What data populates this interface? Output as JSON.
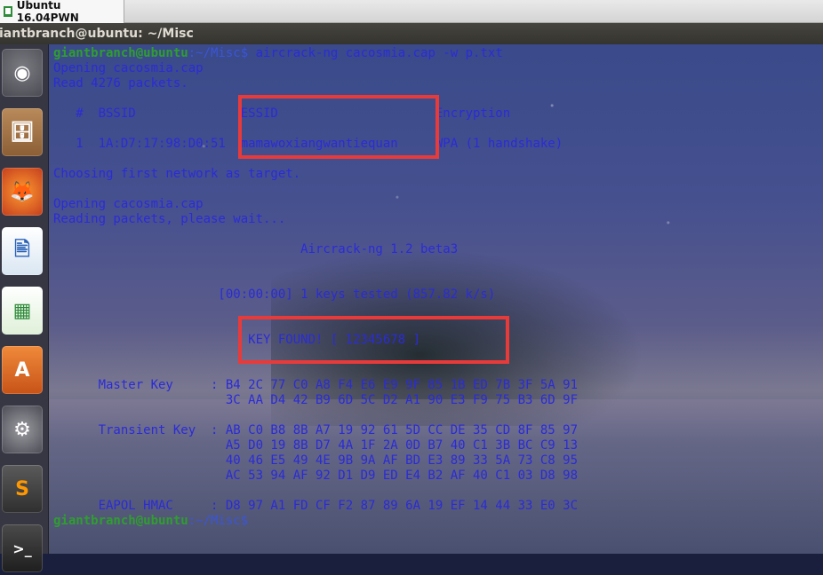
{
  "vm_tab": {
    "title": "Ubuntu 16.04PWN"
  },
  "window": {
    "title": "iantbranch@ubuntu: ~/Misc"
  },
  "launcher": {
    "items": [
      {
        "name": "ubuntu-dash-icon",
        "glyph": "◉"
      },
      {
        "name": "files-icon",
        "glyph": "🗄"
      },
      {
        "name": "firefox-icon",
        "glyph": "🦊"
      },
      {
        "name": "libreoffice-writer-icon",
        "glyph": "🖹"
      },
      {
        "name": "libreoffice-calc-icon",
        "glyph": "▦"
      },
      {
        "name": "software-center-icon",
        "glyph": "A"
      },
      {
        "name": "system-settings-icon",
        "glyph": "⚙"
      },
      {
        "name": "sublime-text-icon",
        "glyph": "S"
      },
      {
        "name": "terminal-icon",
        "glyph": ">_"
      }
    ]
  },
  "terminal": {
    "prompt_user": "giantbranch@ubuntu",
    "prompt_path": ":~/Misc",
    "prompt_symbol": "$",
    "command": " aircrack-ng cacosmia.cap -w p.txt",
    "lines": [
      "Opening cacosmia.cap",
      "Read 4276 packets.",
      "",
      "   #  BSSID              ESSID                     Encryption",
      "",
      "   1  1A:D7:17:98:D0:51  mamawoxiangwantiequan     WPA (1 handshake)",
      "",
      "Choosing first network as target.",
      "",
      "Opening cacosmia.cap",
      "Reading packets, please wait...",
      "",
      "                                 Aircrack-ng 1.2 beta3",
      "",
      "",
      "                      [00:00:00] 1 keys tested (857.82 k/s)",
      "",
      "",
      "                          KEY FOUND! [ 12345678 ]",
      "",
      "",
      "      Master Key     : B4 2C 77 C0 A8 F4 E6 E9 9F 85 1B ED 7B 3F 5A 91",
      "                       3C AA D4 42 B9 6D 5C D2 A1 90 E3 F9 75 B3 6D 9F",
      "",
      "      Transient Key  : AB C0 B8 8B A7 19 92 61 5D CC DE 35 CD 8F 85 97",
      "                       A5 D0 19 8B D7 4A 1F 2A 0D B7 40 C1 3B BC C9 13",
      "                       40 46 E5 49 4E 9B 9A AF BD E3 89 33 5A 73 C8 95",
      "                       AC 53 94 AF 92 D1 D9 ED E4 B2 AF 40 C1 03 D8 98",
      "",
      "      EAPOL HMAC     : D8 97 A1 FD CF F2 87 89 6A 19 EF 14 44 33 E0 3C"
    ],
    "final_prompt_user": "giantbranch@ubuntu",
    "final_prompt_path": ":~/Misc",
    "final_prompt_symbol": "$"
  },
  "highlight_color": "#e93a3a"
}
